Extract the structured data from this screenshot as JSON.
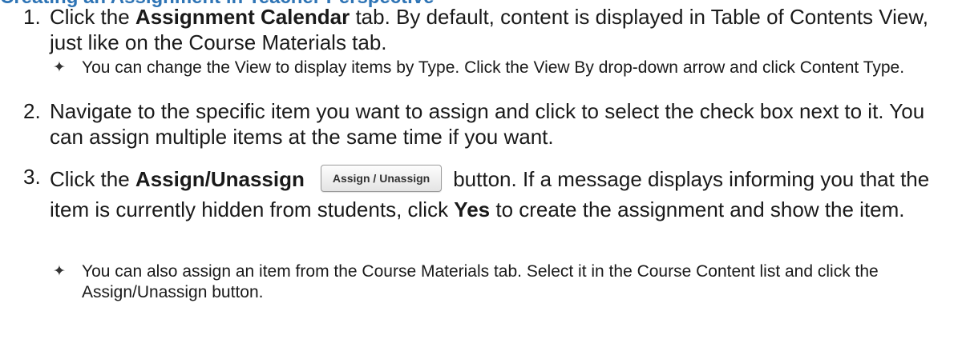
{
  "heading": "Creating an Assignment in Teacher Perspective",
  "steps": [
    {
      "number": "1.",
      "before": "Click the ",
      "bold1": "Assignment Calendar",
      "middle": " tab. By default, content is displayed in Table of Contents View, just like on the Course Materials tab."
    },
    {
      "number": "2.",
      "text": "Navigate to the specific item you want to assign and click to select the check box next to it. You can assign multiple items at the same time if you want."
    },
    {
      "number": "3.",
      "before": "Click the ",
      "bold1": "Assign/Unassign",
      "button_label": "Assign / Unassign",
      "middle": "button. If a message displays informing you that the item is currently hidden from students, click ",
      "bold2": "Yes",
      "after": " to create the assignment and show the item."
    }
  ],
  "notes": [
    {
      "symbol": "✦",
      "text": "You can change the View to display items by Type. Click the View By drop-down arrow and click Content Type."
    },
    {
      "symbol": "✦",
      "text": "You can also assign an item from the Course Materials tab. Select it in the Course Content list and click the Assign/Unassign button."
    }
  ]
}
